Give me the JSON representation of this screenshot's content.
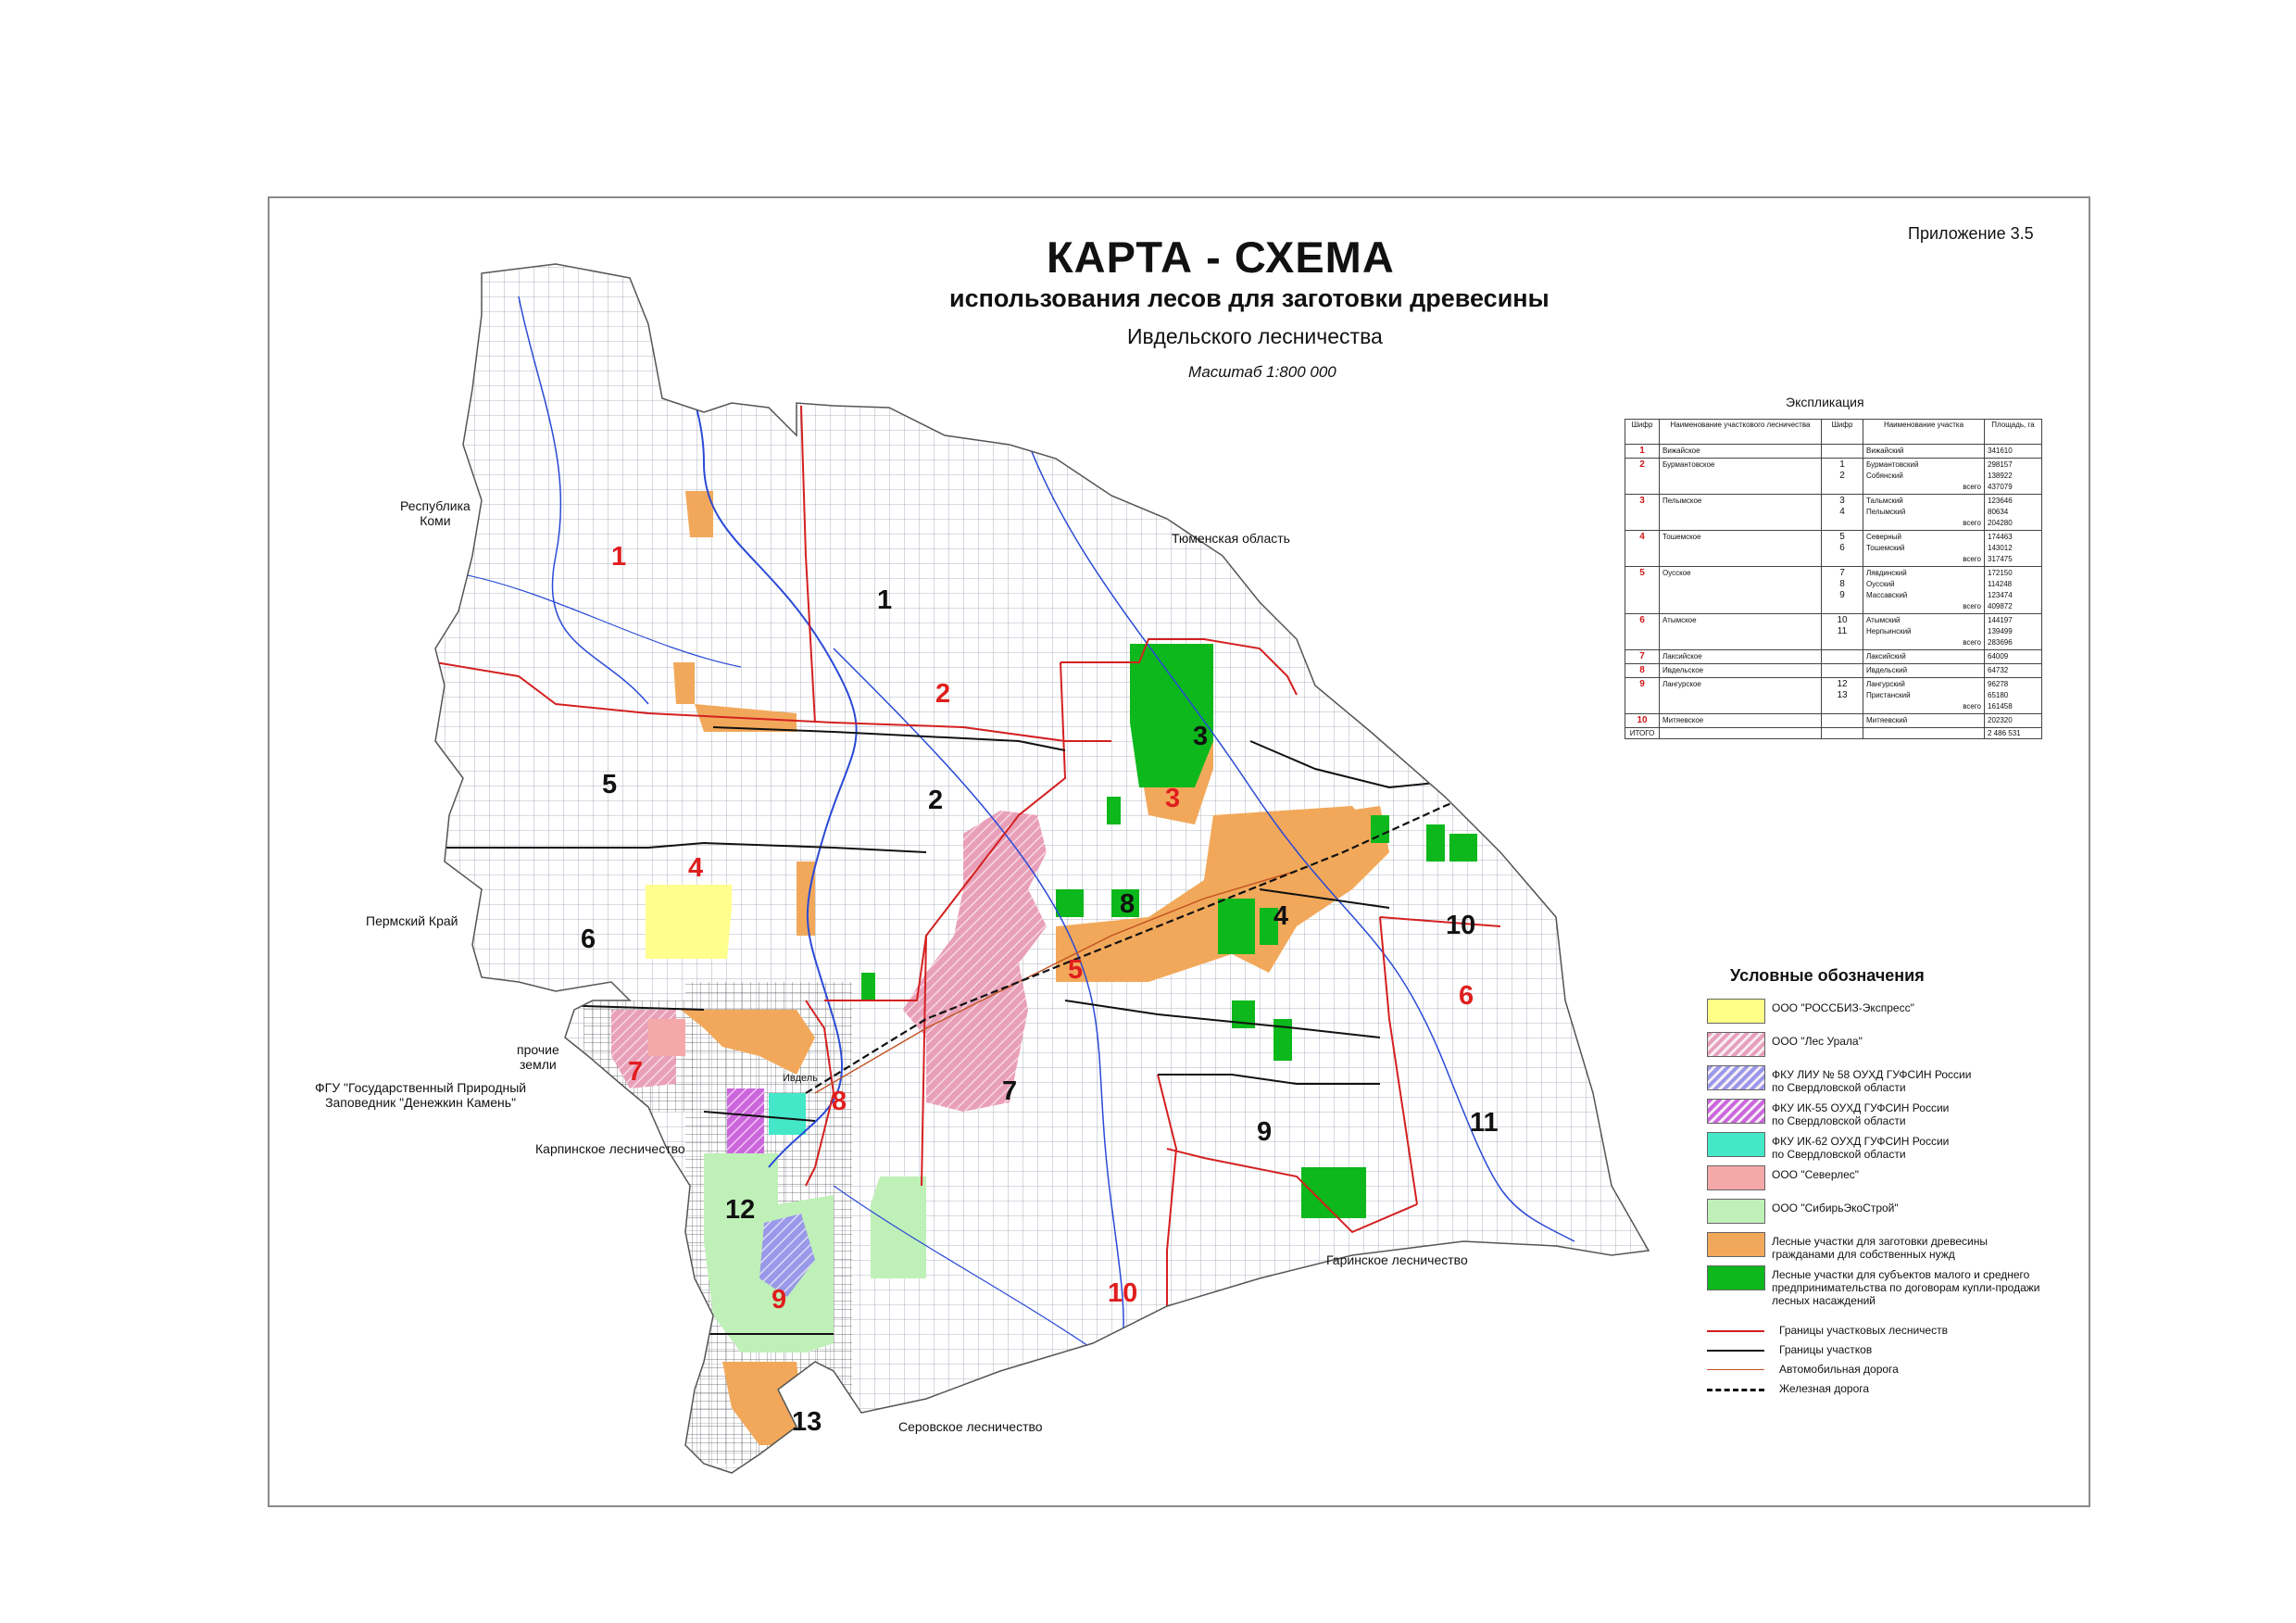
{
  "header": {
    "title": "КАРТА - СХЕМА",
    "subtitle": "использования лесов для заготовки древесины",
    "subtitle2": "Ивдельского лесничества",
    "scale": "Масштаб 1:800 000",
    "appendix": "Приложение 3.5"
  },
  "map_labels": {
    "komi": "Республика\nКоми",
    "tyumen": "Тюменская область",
    "perm": "Пермский Край",
    "other_lands": "прочие\nземли",
    "reserve": "ФГУ \"Государственный Природный\nЗаповедник \"Денежкин Камень\"",
    "karpinsk": "Карпинское лесничество",
    "ivdel": "Ивдель",
    "garinsk": "Гаринское лесничество",
    "serov": "Серовское лесничество"
  },
  "district_numbers_red": [
    "1",
    "2",
    "3",
    "4",
    "5",
    "6",
    "7",
    "8",
    "9",
    "10"
  ],
  "plot_numbers_black": [
    "1",
    "2",
    "3",
    "4",
    "5",
    "6",
    "7",
    "8",
    "9",
    "10",
    "11",
    "12",
    "13"
  ],
  "explication": {
    "title": "Экспликация",
    "headers": [
      "Шифр",
      "Наименование участкового лесничества",
      "Шифр",
      "Наименование участка",
      "Площадь, га"
    ],
    "rows": [
      {
        "code": "1",
        "forestry": "Вижайское",
        "codes": [],
        "plots": [
          "Вижайский"
        ],
        "areas": [
          "341610"
        ]
      },
      {
        "code": "2",
        "forestry": "Бурмантовское",
        "codes": [
          "1",
          "2"
        ],
        "plots": [
          "Бурмантовский",
          "Собянский",
          "всего"
        ],
        "areas": [
          "298157",
          "138922",
          "437079"
        ]
      },
      {
        "code": "3",
        "forestry": "Пелымское",
        "codes": [
          "3",
          "4"
        ],
        "plots": [
          "Тальмский",
          "Пелымский",
          "всего"
        ],
        "areas": [
          "123646",
          "80634",
          "204280"
        ]
      },
      {
        "code": "4",
        "forestry": "Тошемское",
        "codes": [
          "5",
          "6"
        ],
        "plots": [
          "Северный",
          "Тошемский",
          "всего"
        ],
        "areas": [
          "174463",
          "143012",
          "317475"
        ]
      },
      {
        "code": "5",
        "forestry": "Оусское",
        "codes": [
          "7",
          "8",
          "9"
        ],
        "plots": [
          "Лявдинский",
          "Оусский",
          "Массавский",
          "всего"
        ],
        "areas": [
          "172150",
          "114248",
          "123474",
          "409872"
        ]
      },
      {
        "code": "6",
        "forestry": "Атымское",
        "codes": [
          "10",
          "11"
        ],
        "plots": [
          "Атымский",
          "Нерпьинский",
          "всего"
        ],
        "areas": [
          "144197",
          "139499",
          "283696"
        ]
      },
      {
        "code": "7",
        "forestry": "Лаксийское",
        "codes": [],
        "plots": [
          "Лаксийский"
        ],
        "areas": [
          "64009"
        ]
      },
      {
        "code": "8",
        "forestry": "Ивдельское",
        "codes": [],
        "plots": [
          "Ивдельский"
        ],
        "areas": [
          "64732"
        ]
      },
      {
        "code": "9",
        "forestry": "Лангурское",
        "codes": [
          "12",
          "13"
        ],
        "plots": [
          "Лангурский",
          "Пристанский",
          "всего"
        ],
        "areas": [
          "96278",
          "65180",
          "161458"
        ]
      },
      {
        "code": "10",
        "forestry": "Митяевское",
        "codes": [],
        "plots": [
          "Митяевский"
        ],
        "areas": [
          "202320"
        ]
      }
    ],
    "total_label": "ИТОГО",
    "total_value": "2 486 531"
  },
  "legend": {
    "title": "Условные обозначения",
    "items": [
      {
        "label": "ООО \"РОССБИЗ-Экспресс\"",
        "color": "#ffff88",
        "pattern": "solid"
      },
      {
        "label": "ООО \"Лес Урала\"",
        "color": "#e8a0b8",
        "pattern": "hatch"
      },
      {
        "label": "ФКУ ЛИУ № 58 ОУХД ГУФСИН России\nпо Свердловской области",
        "color": "#9a98e8",
        "pattern": "hatch"
      },
      {
        "label": "ФКУ ИК-55 ОУХД ГУФСИН России\nпо Свердловской области",
        "color": "#cc66dd",
        "pattern": "hatch"
      },
      {
        "label": "ФКУ ИК-62 ОУХД ГУФСИН России\nпо Свердловской области",
        "color": "#44e8c8",
        "pattern": "solid"
      },
      {
        "label": "ООО \"Северлес\"",
        "color": "#f4a8a8",
        "pattern": "solid"
      },
      {
        "label": "ООО \"СибирьЭкоСтрой\"",
        "color": "#bff0b8",
        "pattern": "solid"
      },
      {
        "label": "Лесные участки для заготовки древесины\nгражданами для собственных нужд",
        "color": "#f2a85a",
        "pattern": "solid"
      },
      {
        "label": "Лесные участки для субъектов малого и среднего\nпредпринимательства по договорам купли-продажи\nлесных насаждений",
        "color": "#0cb81c",
        "pattern": "solid"
      }
    ],
    "lines": [
      {
        "label": "Границы участковых лесничеств",
        "color": "#d42020",
        "style": "solid"
      },
      {
        "label": "Границы участков",
        "color": "#111111",
        "style": "solid"
      },
      {
        "label": "Автомобильная дорога",
        "color": "#c05020",
        "style": "thin"
      },
      {
        "label": "Железная дорога",
        "color": "#111111",
        "style": "dashed"
      }
    ]
  }
}
